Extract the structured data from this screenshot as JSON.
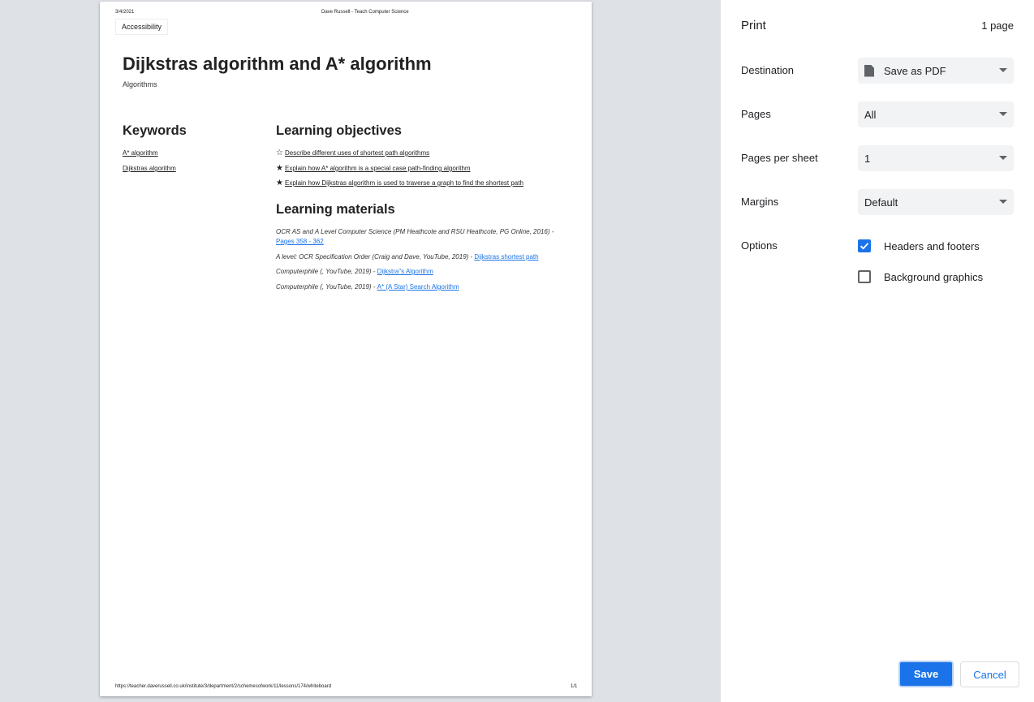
{
  "preview": {
    "header_date": "3/4/2021",
    "header_title": "Dave Russell - Teach Computer Science",
    "accessibility_label": "Accessibility",
    "page_title": "Dijkstras algorithm and A* algorithm",
    "subtitle": "Algorithms",
    "keywords_heading": "Keywords",
    "keywords": [
      "A* algorithm",
      "Dijkstras algorithm"
    ],
    "objectives_heading": "Learning objectives",
    "objectives": [
      {
        "icon": "star-outline-icon",
        "text": "Describe different uses of shortest path algorithms"
      },
      {
        "icon": "star-filled-icon",
        "text": "Explain how A* algorithm is a special case path-finding algorithm"
      },
      {
        "icon": "star-filled-icon",
        "text": "Explain how Dijkstras algorithm is used to traverse a graph to find the shortest path"
      }
    ],
    "materials_heading": "Learning materials",
    "materials": [
      {
        "source": "OCR AS and A Level Computer Science (PM Heathcote and RSU Heathcote, PG Online, 2016) - ",
        "link": "Pages 358 - 362"
      },
      {
        "source": "A level: OCR Specification Order (Craig and Dave, YouTube, 2019) - ",
        "link": "Dijkstras shortest path"
      },
      {
        "source": "Computerphile (, YouTube, 2019) - ",
        "link": "Dijkstra\"s Algorithm"
      },
      {
        "source": "Computerphile (, YouTube, 2019) - ",
        "link": "A* (A Star) Search Algorithm"
      }
    ],
    "footer_url": "https://teacher.daverussell.co.uk/institute/3/department/2/schemesofwork/11/lessons/174/whiteboard",
    "footer_page": "1/1"
  },
  "print_panel": {
    "title": "Print",
    "page_count": "1 page",
    "destination_label": "Destination",
    "destination_value": "Save as PDF",
    "pages_label": "Pages",
    "pages_value": "All",
    "pages_per_sheet_label": "Pages per sheet",
    "pages_per_sheet_value": "1",
    "margins_label": "Margins",
    "margins_value": "Default",
    "options_label": "Options",
    "headers_footers_label": "Headers and footers",
    "headers_footers_checked": true,
    "background_graphics_label": "Background graphics",
    "background_graphics_checked": false,
    "save_label": "Save",
    "cancel_label": "Cancel"
  },
  "colors": {
    "accent": "#1a73e8",
    "preview_bg": "#dee1e6"
  }
}
